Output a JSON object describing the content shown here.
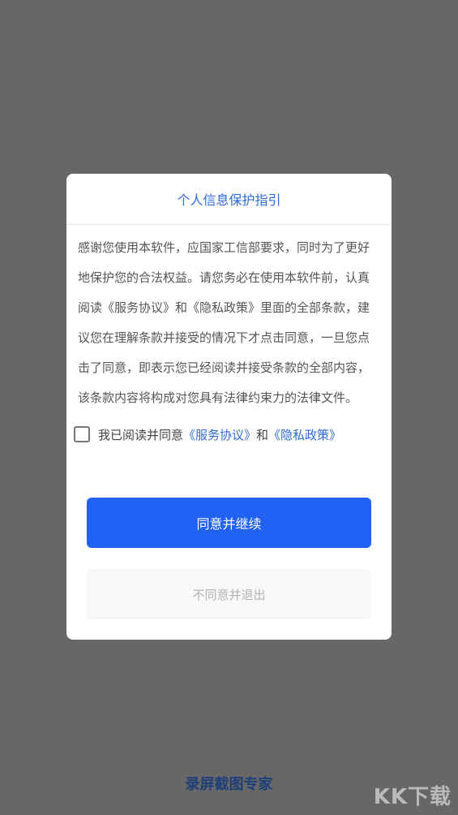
{
  "dialog": {
    "title": "个人信息保护指引",
    "body_text": "感谢您使用本软件，应国家工信部要求，同时为了更好地保护您的合法权益。请您务必在使用本软件前，认真阅读《服务协议》和《隐私政策》里面的全部条款，建议您在理解条款并接受的情况下才点击同意，一旦您点击了同意，即表示您已经阅读并接受条款的全部内容，该条款内容将构成对您具有法律约束力的法律文件。",
    "consent": {
      "prefix": "我已阅读并同意",
      "service_link": "《服务协议》",
      "conjunction": "和",
      "privacy_link": "《隐私政策》"
    },
    "agree_button": "同意并继续",
    "decline_button": "不同意并退出"
  },
  "footer": {
    "brand": "录屏截图专家",
    "watermark": "KK下载"
  },
  "colors": {
    "overlay": "#676767",
    "accent": "#2162f5",
    "link": "#2f6bd8"
  }
}
